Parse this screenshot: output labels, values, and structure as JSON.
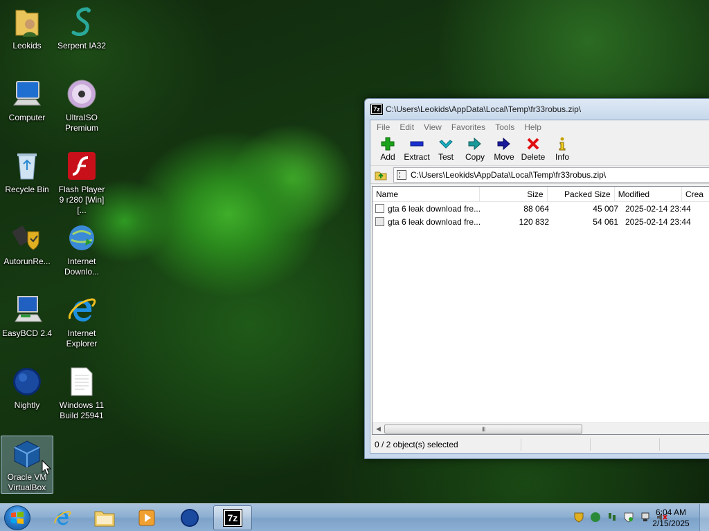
{
  "desktop": {
    "icons": [
      {
        "label": "Leokids",
        "icon": "user-folder-icon"
      },
      {
        "label": "Serpent IA32",
        "icon": "serpent-icon"
      },
      {
        "label": "Computer",
        "icon": "computer-icon"
      },
      {
        "label": "UltraISO Premium",
        "icon": "disc-icon"
      },
      {
        "label": "Recycle Bin",
        "icon": "recycle-bin-icon"
      },
      {
        "label": "Flash Player 9 r280 [Win] [...",
        "icon": "flash-icon"
      },
      {
        "label": "AutorunRe...",
        "icon": "usb-shield-icon"
      },
      {
        "label": "Internet Downlo...",
        "icon": "idm-globe-icon"
      },
      {
        "label": "EasyBCD 2.4",
        "icon": "easybcd-icon"
      },
      {
        "label": "Internet Explorer",
        "icon": "ie-icon"
      },
      {
        "label": "Nightly",
        "icon": "nightly-globe-icon"
      },
      {
        "label": "Windows 11 Build 25941",
        "icon": "text-file-icon"
      },
      {
        "label": "Oracle VM VirtualBox",
        "icon": "virtualbox-icon"
      }
    ]
  },
  "window": {
    "app_badge": "7z",
    "title": "C:\\Users\\Leokids\\AppData\\Local\\Temp\\fr33robus.zip\\",
    "menu": [
      "File",
      "Edit",
      "View",
      "Favorites",
      "Tools",
      "Help"
    ],
    "toolbar": [
      {
        "label": "Add",
        "icon": "plus-icon",
        "color": "#1aa31a"
      },
      {
        "label": "Extract",
        "icon": "minus-icon",
        "color": "#1a2fd0"
      },
      {
        "label": "Test",
        "icon": "check-icon",
        "color": "#1aa3b0"
      },
      {
        "label": "Copy",
        "icon": "double-arrow-icon",
        "color": "#1a9a9a"
      },
      {
        "label": "Move",
        "icon": "arrow-right-icon",
        "color": "#1a1aa0"
      },
      {
        "label": "Delete",
        "icon": "x-icon",
        "color": "#e01010"
      },
      {
        "label": "Info",
        "icon": "info-icon",
        "color": "#c8a000"
      }
    ],
    "address": "C:\\Users\\Leokids\\AppData\\Local\\Temp\\fr33robus.zip\\",
    "columns": [
      "Name",
      "Size",
      "Packed Size",
      "Modified",
      "Crea"
    ],
    "rows": [
      {
        "name": "gta 6 leak download fre...",
        "size": "88 064",
        "packed": "45 007",
        "modified": "2025-02-14 23:44"
      },
      {
        "name": "gta 6 leak download fre...",
        "size": "120 832",
        "packed": "54 061",
        "modified": "2025-02-14 23:44"
      }
    ],
    "scroll_thumb": "III",
    "status": "0 / 2 object(s) selected"
  },
  "taskbar": {
    "pinned": [
      "internet-explorer",
      "file-explorer",
      "media-player",
      "nightly",
      "7-zip"
    ],
    "active_label": "7z",
    "clock": {
      "time": "6:04 AM",
      "date": "2/15/2025"
    }
  }
}
